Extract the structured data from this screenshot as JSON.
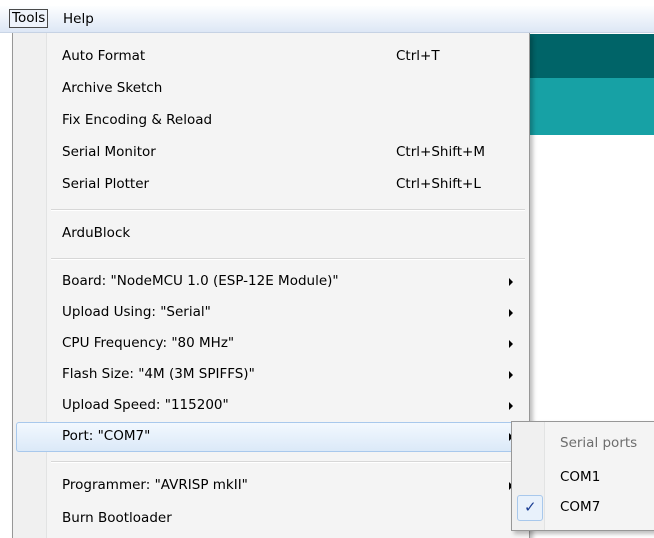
{
  "menubar": {
    "tools": "Tools",
    "help": "Help"
  },
  "tools_menu": {
    "items": [
      {
        "label": "Auto Format",
        "shortcut": "Ctrl+T"
      },
      {
        "label": "Archive Sketch",
        "shortcut": ""
      },
      {
        "label": "Fix Encoding & Reload",
        "shortcut": ""
      },
      {
        "label": "Serial Monitor",
        "shortcut": "Ctrl+Shift+M"
      },
      {
        "label": "Serial Plotter",
        "shortcut": "Ctrl+Shift+L"
      },
      {
        "label": "ArduBlock",
        "shortcut": ""
      },
      {
        "label": "Board: \"NodeMCU 1.0 (ESP-12E Module)\"",
        "shortcut": ""
      },
      {
        "label": "Upload Using: \"Serial\"",
        "shortcut": ""
      },
      {
        "label": "CPU Frequency: \"80 MHz\"",
        "shortcut": ""
      },
      {
        "label": "Flash Size: \"4M (3M SPIFFS)\"",
        "shortcut": ""
      },
      {
        "label": "Upload Speed: \"115200\"",
        "shortcut": ""
      },
      {
        "label": "Port: \"COM7\"",
        "shortcut": ""
      },
      {
        "label": "Programmer: \"AVRISP mkII\"",
        "shortcut": ""
      },
      {
        "label": "Burn Bootloader",
        "shortcut": ""
      }
    ]
  },
  "port_submenu": {
    "header": "Serial ports",
    "items": [
      {
        "label": "COM1",
        "checked": false
      },
      {
        "label": "COM7",
        "checked": true
      }
    ],
    "check_glyph": "✓"
  },
  "colors": {
    "accent_dark": "#006468",
    "accent_light": "#17a1a5",
    "highlight_border": "#a8c8ec"
  }
}
